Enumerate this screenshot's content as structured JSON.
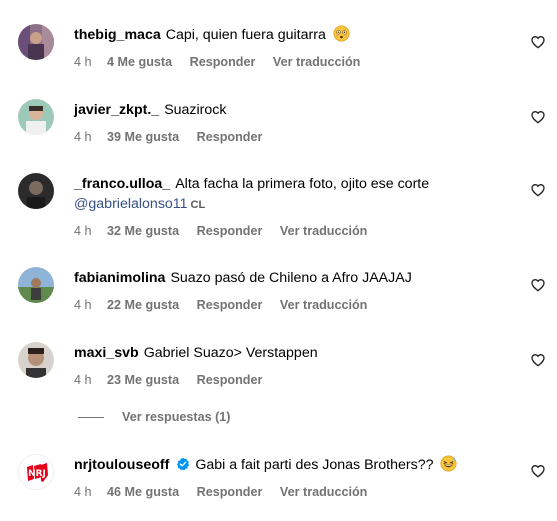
{
  "comments": [
    {
      "username": "thebig_maca",
      "text": "Capi, quien fuera guitarra",
      "emoji": "flushed-face",
      "time": "4 h",
      "likes": "4 Me gusta",
      "reply": "Responder",
      "translate": "Ver traducción"
    },
    {
      "username": "javier_zkpt._",
      "text": "Suazirock",
      "time": "4 h",
      "likes": "39 Me gusta",
      "reply": "Responder"
    },
    {
      "username": "_franco.ulloa_",
      "text": "Alta facha la primera foto, ojito ese corte",
      "mention": "@gabrielalonso11",
      "country": "CL",
      "time": "4 h",
      "likes": "32 Me gusta",
      "reply": "Responder",
      "translate": "Ver traducción"
    },
    {
      "username": "fabianimolina",
      "text": "Suazo pasó de Chileno a Afro JAAJAJ",
      "time": "4 h",
      "likes": "22 Me gusta",
      "reply": "Responder",
      "translate": "Ver traducción"
    },
    {
      "username": "maxi_svb",
      "text": "Gabriel Suazo> Verstappen",
      "time": "4 h",
      "likes": "23 Me gusta",
      "reply": "Responder",
      "view_replies": "Ver respuestas (1)"
    },
    {
      "username": "nrjtoulouseoff",
      "verified": true,
      "text": "Gabi a fait parti des Jonas Brothers??",
      "emoji": "grinning-squinting-face-with-sweat",
      "time": "4 h",
      "likes": "46 Me gusta",
      "reply": "Responder",
      "translate": "Ver traducción"
    }
  ],
  "icons": {
    "like": "heart-outline-icon",
    "verified": "verified-badge-icon"
  },
  "colors": {
    "text": "#000000",
    "meta": "#737373",
    "mention": "#385185",
    "verified": "#0095f6"
  }
}
